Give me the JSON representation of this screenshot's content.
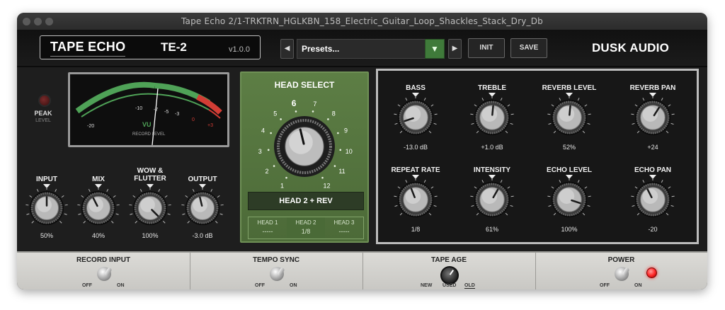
{
  "window": {
    "title": "Tape Echo 2/1-TRKTRN_HGLKBN_158_Electric_Guitar_Loop_Shackles_Stack_Dry_Db"
  },
  "header": {
    "brand_primary": "TAPE ECHO",
    "brand_model": "TE-2",
    "version": "v1.0.0",
    "preset_label": "Presets...",
    "init_label": "INIT",
    "save_label": "SAVE",
    "company": "DUSK AUDIO",
    "prev_icon": "◀",
    "next_icon": "▶",
    "dropdown_icon": "▼"
  },
  "meter": {
    "peak_label": "PEAK",
    "peak_sub": "LEVEL",
    "vu_label": "VU",
    "vu_sub": "RECORD LEVEL",
    "scale": [
      "-20",
      "-10",
      "-7",
      "-5",
      "-3",
      "0",
      "+3"
    ]
  },
  "left_knobs": [
    {
      "label": "INPUT",
      "value": "50%",
      "level": 0.5
    },
    {
      "label": "MIX",
      "value": "40%",
      "level": 0.4
    },
    {
      "label": "WOW &\nFLUTTER",
      "value": "100%",
      "level": 1.0
    },
    {
      "label": "OUTPUT",
      "value": "-3.0 dB",
      "level": 0.45
    }
  ],
  "head_select": {
    "title": "HEAD SELECT",
    "positions": [
      "1",
      "2",
      "3",
      "4",
      "5",
      "6",
      "7",
      "8",
      "9",
      "10",
      "11",
      "12"
    ],
    "selected": 6,
    "mode_label": "HEAD 2 + REV",
    "heads": [
      {
        "label": "HEAD 1",
        "value": "-----"
      },
      {
        "label": "HEAD 2",
        "value": "1/8"
      },
      {
        "label": "HEAD 3",
        "value": "-----"
      }
    ]
  },
  "right_knobs": [
    {
      "label": "BASS",
      "value": "-13.0 dB",
      "level": 0.1
    },
    {
      "label": "TREBLE",
      "value": "+1.0 dB",
      "level": 0.52
    },
    {
      "label": "REVERB LEVEL",
      "value": "52%",
      "level": 0.52
    },
    {
      "label": "REVERB PAN",
      "value": "+24",
      "level": 0.62
    },
    {
      "label": "REPEAT RATE",
      "value": "1/8",
      "level": 0.42
    },
    {
      "label": "INTENSITY",
      "value": "61%",
      "level": 0.61
    },
    {
      "label": "ECHO LEVEL",
      "value": "100%",
      "level": 0.9
    },
    {
      "label": "ECHO PAN",
      "value": "-20",
      "level": 0.4
    }
  ],
  "bottom": {
    "record_input": {
      "title": "RECORD INPUT",
      "off": "OFF",
      "on": "ON"
    },
    "tempo_sync": {
      "title": "TEMPO SYNC",
      "off": "OFF",
      "on": "ON"
    },
    "tape_age": {
      "title": "TAPE AGE",
      "options": [
        "NEW",
        "USED",
        "OLD"
      ],
      "selected": "OLD"
    },
    "power": {
      "title": "POWER",
      "off": "OFF",
      "on": "ON"
    }
  },
  "colors": {
    "accent_green": "#5d7e45",
    "led_red": "#ff2a2a",
    "meter_green": "#4fa257",
    "meter_red": "#d23d35"
  },
  "icons": [
    "record-led-icon",
    "power-led-icon",
    "dropdown-arrow-icon",
    "chevron-left-icon",
    "chevron-right-icon"
  ]
}
